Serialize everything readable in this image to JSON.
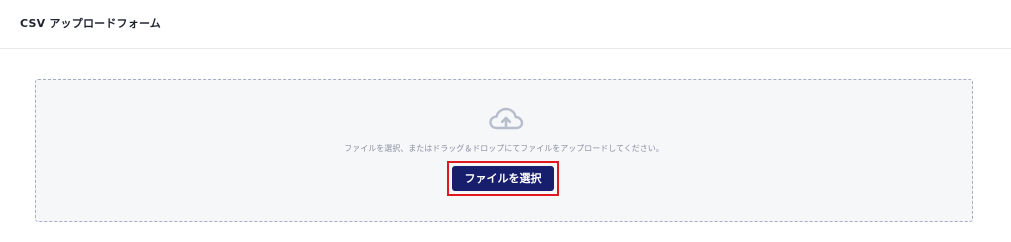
{
  "header": {
    "title": "CSV アップロードフォーム"
  },
  "dropzone": {
    "icon": "cloud-upload-icon",
    "instruction": "ファイルを選択、またはドラッグ＆ドロップにてファイルをアップロードしてください。",
    "button_label": "ファイルを選択"
  },
  "colors": {
    "button_bg": "#171e6c",
    "highlight_border": "#e0191f",
    "dropzone_border": "#a7acc5",
    "dropzone_bg": "#f6f7f9"
  }
}
